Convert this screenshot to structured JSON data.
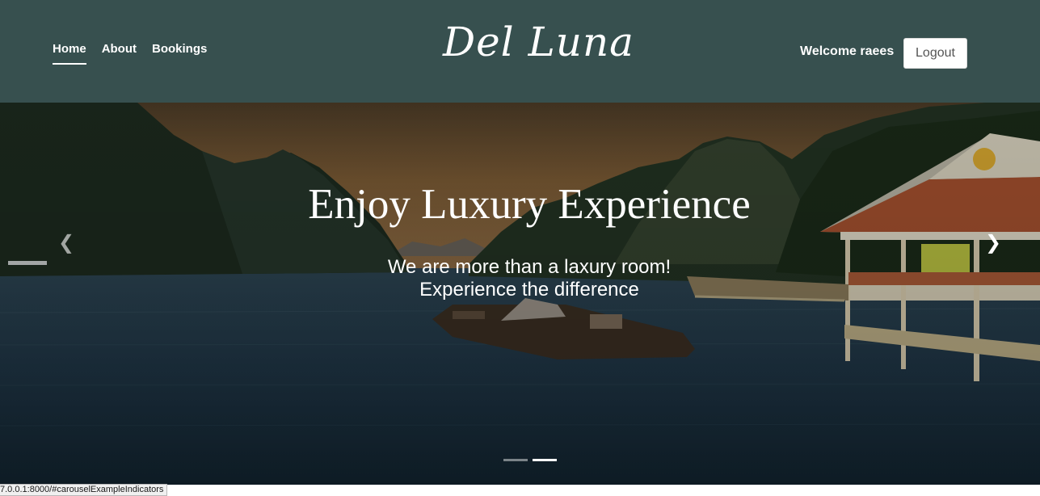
{
  "navbar": {
    "links": [
      {
        "label": "Home",
        "active": true
      },
      {
        "label": "About"
      },
      {
        "label": "Bookings"
      }
    ],
    "brand": "Del Luna",
    "welcome_text": "Welcome raees",
    "logout_label": "Logout",
    "background_color": "#37504f"
  },
  "hero": {
    "title": "Enjoy Luxury Experience",
    "subtitle_line1": "We are more than a laxury room!",
    "subtitle_line2": "Experience the difference",
    "prev_icon": "chevron-left-icon",
    "next_icon": "chevron-right-icon",
    "prev_glyph": "❮",
    "next_glyph": "❯",
    "active_slide": 2,
    "slide_count": 2
  },
  "status_bar": {
    "url": "7.0.0.1:8000/#carouselExampleIndicators"
  }
}
